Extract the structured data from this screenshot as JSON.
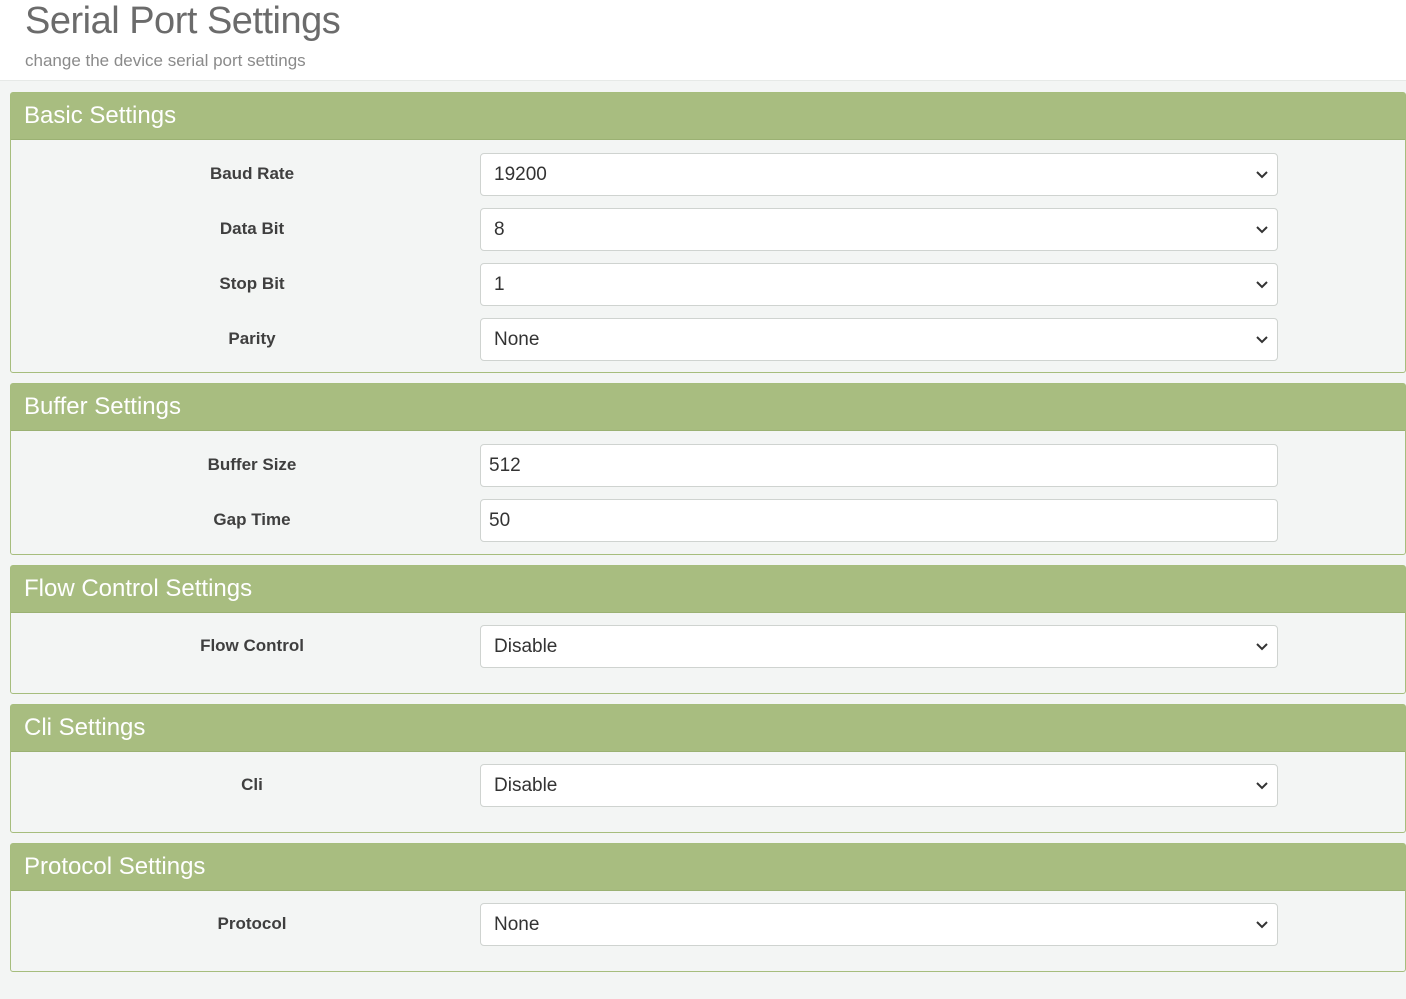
{
  "header": {
    "title": "Serial Port Settings",
    "subtitle": "change the device serial port settings"
  },
  "basic": {
    "title": "Basic Settings",
    "baud_rate": {
      "label": "Baud Rate",
      "value": "19200"
    },
    "data_bit": {
      "label": "Data Bit",
      "value": "8"
    },
    "stop_bit": {
      "label": "Stop Bit",
      "value": "1"
    },
    "parity": {
      "label": "Parity",
      "value": "None"
    }
  },
  "buffer": {
    "title": "Buffer Settings",
    "buffer_size": {
      "label": "Buffer Size",
      "value": "512"
    },
    "gap_time": {
      "label": "Gap Time",
      "value": "50"
    }
  },
  "flow": {
    "title": "Flow Control Settings",
    "flow_control": {
      "label": "Flow Control",
      "value": "Disable"
    }
  },
  "cli": {
    "title": "Cli Settings",
    "cli": {
      "label": "Cli",
      "value": "Disable"
    }
  },
  "protocol": {
    "title": "Protocol Settings",
    "protocol": {
      "label": "Protocol",
      "value": "None"
    }
  },
  "icons": {
    "select_arrow": "chevron-down-icon"
  },
  "colors": {
    "panel_header": "#a8bd80",
    "panel_border": "#a6bd7d",
    "page_background": "#f3f5f4",
    "title_text": "#6b6b6b"
  }
}
